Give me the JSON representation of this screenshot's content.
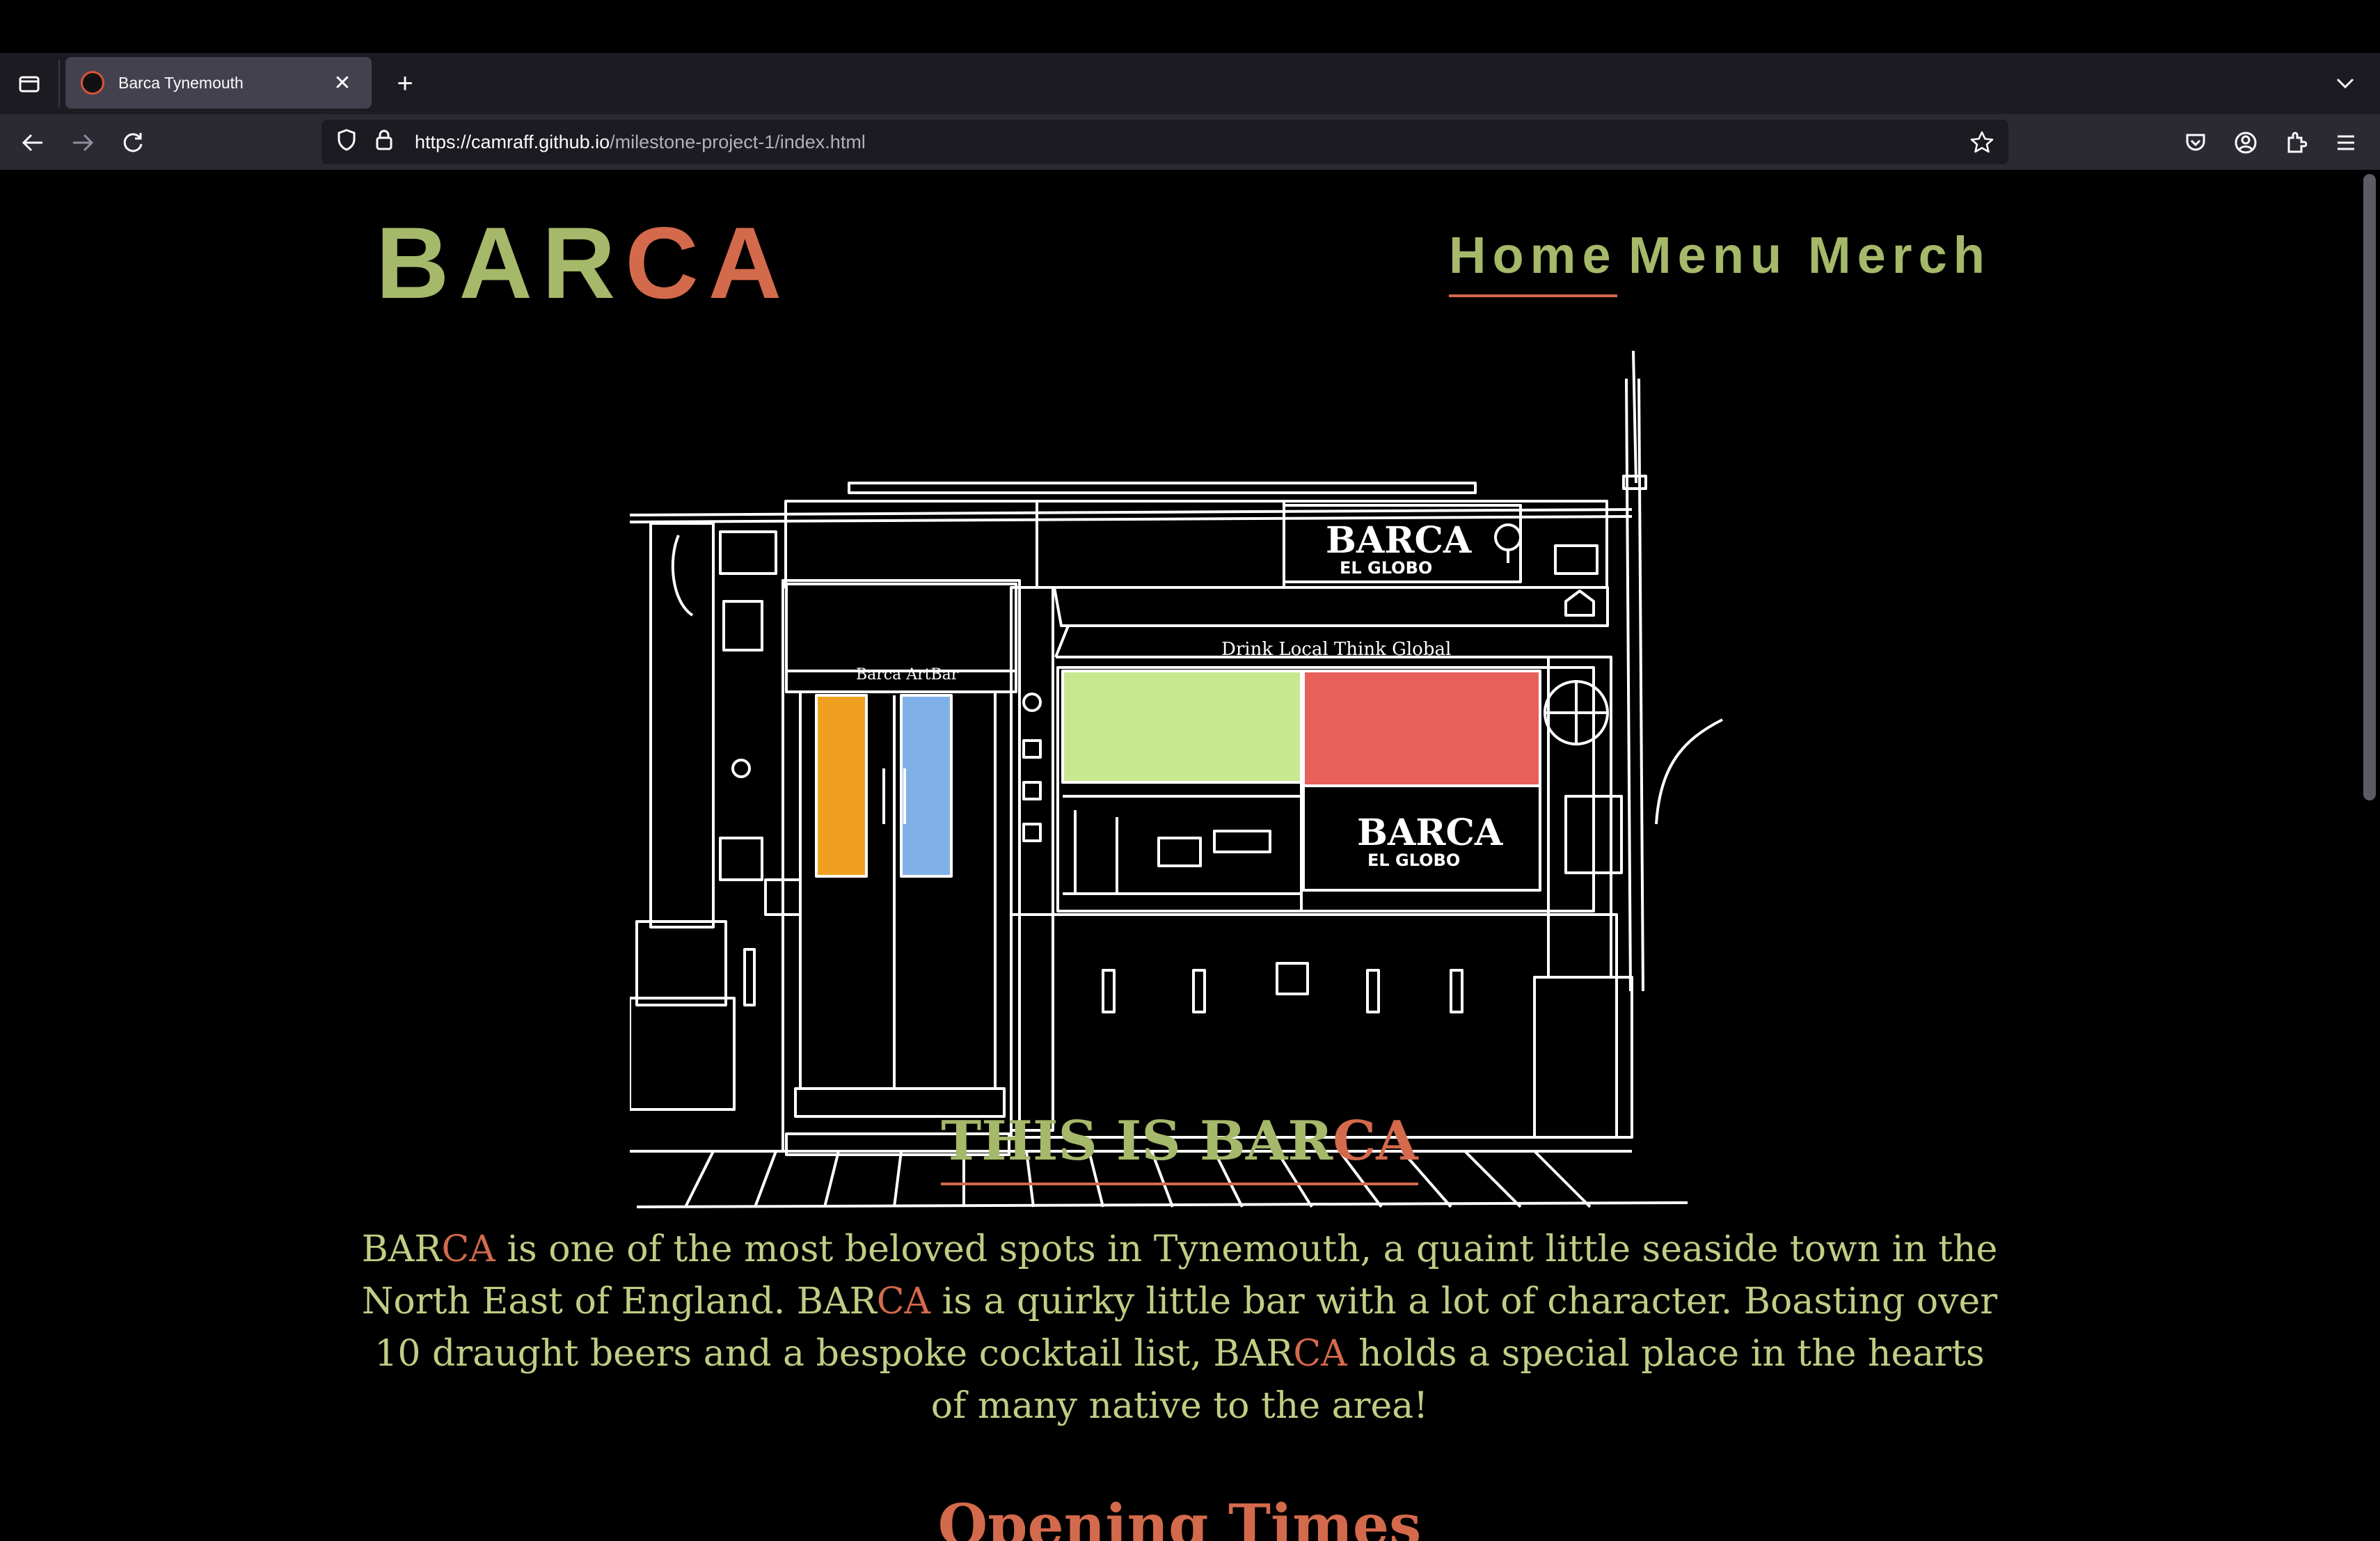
{
  "browser": {
    "tab_title": "Barca Tynemouth",
    "url_host": "https://camraff.github.io",
    "url_path": "/milestone-project-1/index.html",
    "icons": [
      "tabs-icon",
      "favicon",
      "close-icon",
      "plus-icon",
      "chevron-down-icon",
      "back-icon",
      "forward-icon",
      "reload-icon",
      "shield-icon",
      "lock-icon",
      "star-icon",
      "pocket-icon",
      "account-icon",
      "extensions-icon",
      "menu-icon"
    ]
  },
  "site": {
    "logo_main": "BAR",
    "logo_accent": "CA",
    "nav": [
      {
        "label": "Home",
        "active": true
      },
      {
        "label": "Menu",
        "active": false
      },
      {
        "label": "Merch",
        "active": false
      }
    ],
    "hero": {
      "sign_top": "BARCA",
      "sign_top_sub": "EL GLOBO",
      "sign_bottom": "BARCA",
      "sign_bottom_sub": "EL GLOBO",
      "awning_text": "Drink Local Think Global",
      "door_sign": "Barca ArtBar",
      "colors": {
        "green_panel": "#c8e890",
        "red_panel": "#e8605a",
        "orange_door": "#f0a020",
        "blue_door": "#80b0e8",
        "line": "#ffffff"
      }
    },
    "about": {
      "title_main": "THIS IS BAR",
      "title_accent": "CA",
      "bar": "BAR",
      "ca": "CA",
      "p1": " is one of the most beloved spots in Tynemouth, a quaint little seaside town in the North East of England. ",
      "p2": " is a quirky little bar with a lot of character. Boasting over 10 draught beers and a bespoke cocktail list, ",
      "p3": " holds a special place in the hearts of many native to the area!"
    },
    "opening_title": "Opening Times",
    "colors": {
      "green": "#a6b86a",
      "accent": "#d46a4c",
      "text": "#c3cc84",
      "background": "#000000"
    }
  }
}
